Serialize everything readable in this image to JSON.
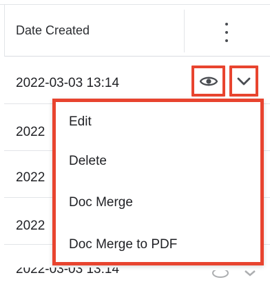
{
  "header": {
    "title": "Date Created"
  },
  "rows": [
    {
      "date": "2022-03-03 13:14"
    },
    {
      "date": "2022"
    },
    {
      "date": "2022"
    },
    {
      "date": "2022"
    },
    {
      "date": "2022-03-03 13:14"
    }
  ],
  "actions": {
    "preview_icon": "eye-icon",
    "menu_toggle_icon": "chevron-down-icon"
  },
  "menu": {
    "items": [
      {
        "label": "Edit"
      },
      {
        "label": "Delete"
      },
      {
        "label": "Doc Merge"
      },
      {
        "label": "Doc Merge to PDF"
      }
    ]
  },
  "colors": {
    "highlight": "#e8442f",
    "icon": "#4a4d52"
  }
}
